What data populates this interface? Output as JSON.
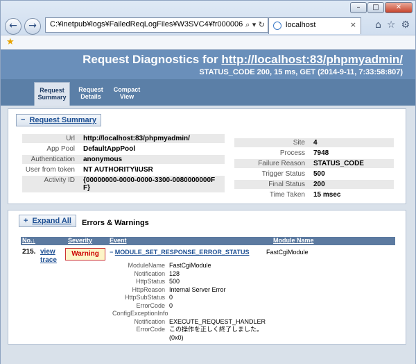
{
  "browser": {
    "window_buttons": [
      "–",
      "□",
      "✕"
    ],
    "address_url": "C:¥inetpub¥logs¥FailedReqLogFiles¥W3SVC4¥fr000006.xml",
    "address_icons": "⌕ ▾ ↻",
    "tab_title": "localhost",
    "tab_close": "×",
    "toolbar_icons": [
      "⌂",
      "☆",
      "⚙"
    ]
  },
  "header": {
    "title_prefix": "Request Diagnostics for ",
    "title_url": "http://localhost:83/phpmyadmin/",
    "subtitle": "STATUS_CODE 200, 15 ms, GET (2014-9-11, 7:33:58:807)"
  },
  "tabs": [
    {
      "label": "Request Summary",
      "active": true
    },
    {
      "label": "Request Details",
      "active": false
    },
    {
      "label": "Compact View",
      "active": false
    }
  ],
  "summary": {
    "toggle_sign": "−",
    "toggle_label": "Request Summary",
    "left": [
      {
        "key": "Url",
        "value": "http://localhost:83/phpmyadmin/"
      },
      {
        "key": "App Pool",
        "value": "DefaultAppPool"
      },
      {
        "key": "Authentication",
        "value": "anonymous"
      },
      {
        "key": "User from token",
        "value": "NT AUTHORITY\\IUSR"
      },
      {
        "key": "Activity ID",
        "value": "{00000000-0000-0000-3300-0080000000FF}"
      }
    ],
    "right": [
      {
        "key": "Site",
        "value": "4"
      },
      {
        "key": "Process",
        "value": "7948"
      },
      {
        "key": "Failure Reason",
        "value": "STATUS_CODE"
      },
      {
        "key": "Trigger Status",
        "value": "500"
      },
      {
        "key": "Final Status",
        "value": "200"
      },
      {
        "key": "Time Taken",
        "value": "15 msec"
      }
    ]
  },
  "errors": {
    "toggle_sign": "+",
    "toggle_label": "Expand All",
    "title": "Errors & Warnings",
    "columns": [
      "No.↓",
      "Severity",
      "Event",
      "Module Name"
    ],
    "row": {
      "number": "215.",
      "view_link": "view",
      "trace_link": "trace",
      "severity": "Warning",
      "event_sign": "−",
      "event": "MODULE_SET_RESPONSE_ERROR_STATUS",
      "module": "FastCgiModule"
    },
    "details": [
      {
        "key": "ModuleName",
        "value": "FastCgiModule"
      },
      {
        "key": "Notification",
        "value": "128"
      },
      {
        "key": "HttpStatus",
        "value": "500"
      },
      {
        "key": "HttpReason",
        "value": "Internal Server Error"
      },
      {
        "key": "HttpSubStatus",
        "value": "0"
      },
      {
        "key": "ErrorCode",
        "value": "0"
      },
      {
        "key": "ConfigExceptionInfo",
        "value": ""
      },
      {
        "key": "Notification",
        "value": "EXECUTE_REQUEST_HANDLER"
      },
      {
        "key": "ErrorCode",
        "value": "この操作を正しく終了しました。"
      },
      {
        "key": "",
        "value": "(0x0)"
      }
    ]
  }
}
